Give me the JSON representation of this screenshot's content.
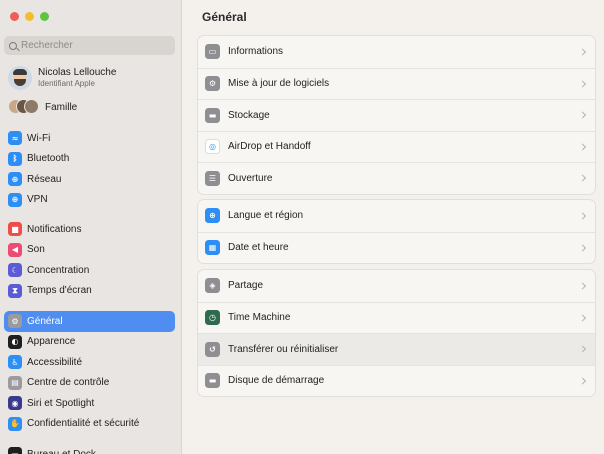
{
  "sidebar": {
    "search_placeholder": "Rechercher",
    "account": {
      "name": "Nicolas Lellouche",
      "subtitle": "Identifiant Apple"
    },
    "family_label": "Famille",
    "group1": [
      {
        "label": "Wi-Fi",
        "icon": "wifi-icon",
        "color": "#2d8ef5",
        "glyph": "≈"
      },
      {
        "label": "Bluetooth",
        "icon": "bluetooth-icon",
        "color": "#2d8ef5",
        "glyph": "ᛒ"
      },
      {
        "label": "Réseau",
        "icon": "globe-icon",
        "color": "#2d8ef5",
        "glyph": "⊕"
      },
      {
        "label": "VPN",
        "icon": "vpn-icon",
        "color": "#2d8ef5",
        "glyph": "⊕"
      }
    ],
    "group2": [
      {
        "label": "Notifications",
        "icon": "bell-icon",
        "color": "#ee4d4a",
        "glyph": "■"
      },
      {
        "label": "Son",
        "icon": "speaker-icon",
        "color": "#ec4b73",
        "glyph": "◀"
      },
      {
        "label": "Concentration",
        "icon": "moon-icon",
        "color": "#5b5bd6",
        "glyph": "☾"
      },
      {
        "label": "Temps d'écran",
        "icon": "hourglass-icon",
        "color": "#5b5bd6",
        "glyph": "⧗"
      }
    ],
    "group3": [
      {
        "label": "Général",
        "icon": "gear-icon",
        "color": "#9a9a9f",
        "glyph": "⚙",
        "selected": true
      },
      {
        "label": "Apparence",
        "icon": "appearance-icon",
        "color": "#1f1f1f",
        "glyph": "◐"
      },
      {
        "label": "Accessibilité",
        "icon": "accessibility-icon",
        "color": "#2d8ef5",
        "glyph": "♿"
      },
      {
        "label": "Centre de contrôle",
        "icon": "control-center-icon",
        "color": "#9a9a9f",
        "glyph": "▤"
      },
      {
        "label": "Siri et Spotlight",
        "icon": "siri-icon",
        "color": "#3a3a8c",
        "glyph": "◉"
      },
      {
        "label": "Confidentialité et sécurité",
        "icon": "hand-icon",
        "color": "#2d8ef5",
        "glyph": "✋"
      }
    ],
    "group4": [
      {
        "label": "Bureau et Dock",
        "icon": "dock-icon",
        "color": "#1f1f1f",
        "glyph": "▭"
      }
    ]
  },
  "main": {
    "title": "Général",
    "cards": [
      [
        {
          "label": "Informations",
          "icon": "info-icon",
          "color": "#8e8e93",
          "glyph": "▭"
        },
        {
          "label": "Mise à jour de logiciels",
          "icon": "software-update-icon",
          "color": "#8e8e93",
          "glyph": "⚙"
        },
        {
          "label": "Stockage",
          "icon": "storage-icon",
          "color": "#8e8e93",
          "glyph": "▬"
        },
        {
          "label": "AirDrop et Handoff",
          "icon": "airdrop-icon",
          "color": "#ffffff",
          "glyph": "◎",
          "glyph_color": "#2d8ef5"
        },
        {
          "label": "Ouverture",
          "icon": "login-items-icon",
          "color": "#8e8e93",
          "glyph": "☰"
        }
      ],
      [
        {
          "label": "Langue et région",
          "icon": "language-icon",
          "color": "#2d8ef5",
          "glyph": "⊕"
        },
        {
          "label": "Date et heure",
          "icon": "calendar-icon",
          "color": "#2d8ef5",
          "glyph": "▦"
        }
      ],
      [
        {
          "label": "Partage",
          "icon": "sharing-icon",
          "color": "#8e8e93",
          "glyph": "◈"
        },
        {
          "label": "Time Machine",
          "icon": "time-machine-icon",
          "color": "#2f6b4f",
          "glyph": "◷"
        },
        {
          "label": "Transférer ou réinitialiser",
          "icon": "reset-icon",
          "color": "#8e8e93",
          "glyph": "↺",
          "hover": true
        },
        {
          "label": "Disque de démarrage",
          "icon": "startup-disk-icon",
          "color": "#8e8e93",
          "glyph": "▬"
        }
      ]
    ]
  }
}
